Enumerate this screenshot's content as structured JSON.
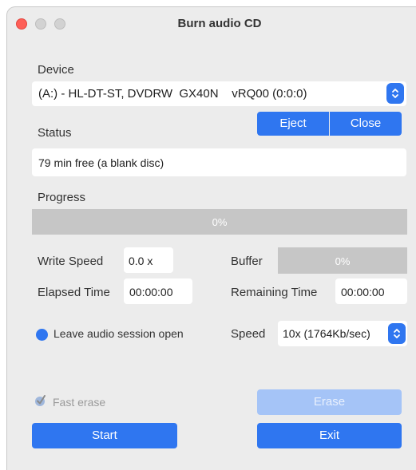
{
  "window": {
    "title": "Burn audio CD"
  },
  "device": {
    "label": "Device",
    "selected": "(A:) - HL-DT-ST, DVDRW  GX40N    vRQ00 (0:0:0)",
    "eject_label": "Eject",
    "close_label": "Close"
  },
  "status": {
    "label": "Status",
    "text": "79 min free (a blank disc)"
  },
  "progress": {
    "label": "Progress",
    "text": "0%",
    "value": 0
  },
  "write_speed": {
    "label": "Write Speed",
    "value": "0.0 x"
  },
  "buffer": {
    "label": "Buffer",
    "text": "0%",
    "value": 0
  },
  "elapsed": {
    "label": "Elapsed Time",
    "value": "00:00:00"
  },
  "remaining": {
    "label": "Remaining Time",
    "value": "00:00:00"
  },
  "leave_open": {
    "label": "Leave audio session open",
    "checked": true
  },
  "speed": {
    "label": "Speed",
    "selected": "10x (1764Kb/sec)"
  },
  "fast_erase": {
    "label": "Fast erase",
    "checked": true,
    "disabled": true
  },
  "buttons": {
    "erase": "Erase",
    "start": "Start",
    "exit": "Exit"
  },
  "colors": {
    "accent": "#2f76f0",
    "accent_disabled": "#a5c4f7",
    "window_bg": "#ececec",
    "bar_bg": "#c6c6c6",
    "traffic_close": "#fe5f57"
  },
  "icons": {
    "stepper": "updown-chevron-icon",
    "fast_erase": "checkmark-icon"
  }
}
